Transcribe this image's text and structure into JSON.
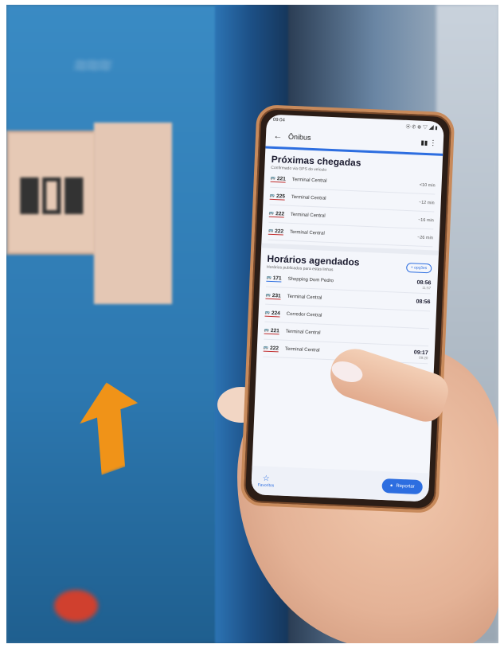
{
  "phone": {
    "statusbar": {
      "time": "09:04",
      "right": "⦿ ✆ ⚙ ▽ ◢ ▮"
    },
    "appbar": {
      "title": "Ônibus"
    },
    "arrivals": {
      "title": "Próximas chegadas",
      "subtitle": "Confirmado via GPS do veículo",
      "rows": [
        {
          "route": "221",
          "dest": "Terminal Central",
          "time": "<10 min"
        },
        {
          "route": "225",
          "dest": "Terminal Central",
          "time": "~12 min"
        },
        {
          "route": "222",
          "dest": "Terminal Central",
          "time": "~16 min"
        },
        {
          "route": "222",
          "dest": "Terminal Central",
          "time": "~26 min"
        }
      ]
    },
    "scheduled": {
      "title": "Horários agendados",
      "subtitle": "Horários publicados para estas linhas",
      "button": "+ opções",
      "rows": [
        {
          "route": "171",
          "dest": "Shopping Dom Pedro",
          "time": "08:56",
          "sub": "11:57",
          "blue": true
        },
        {
          "route": "231",
          "dest": "Terminal Central",
          "time": "08:56",
          "sub": "",
          "blue": false
        },
        {
          "route": "224",
          "dest": "Corredor Central",
          "time": "",
          "sub": "",
          "blue": false
        },
        {
          "route": "221",
          "dest": "Terminal Central",
          "time": "",
          "sub": "",
          "blue": false
        },
        {
          "route": "222",
          "dest": "Terminal Central",
          "time": "09:17",
          "sub": "09:20",
          "blue": false
        }
      ]
    },
    "bottom": {
      "fav_label": "Favoritos",
      "fab_label": "Reportar"
    }
  }
}
